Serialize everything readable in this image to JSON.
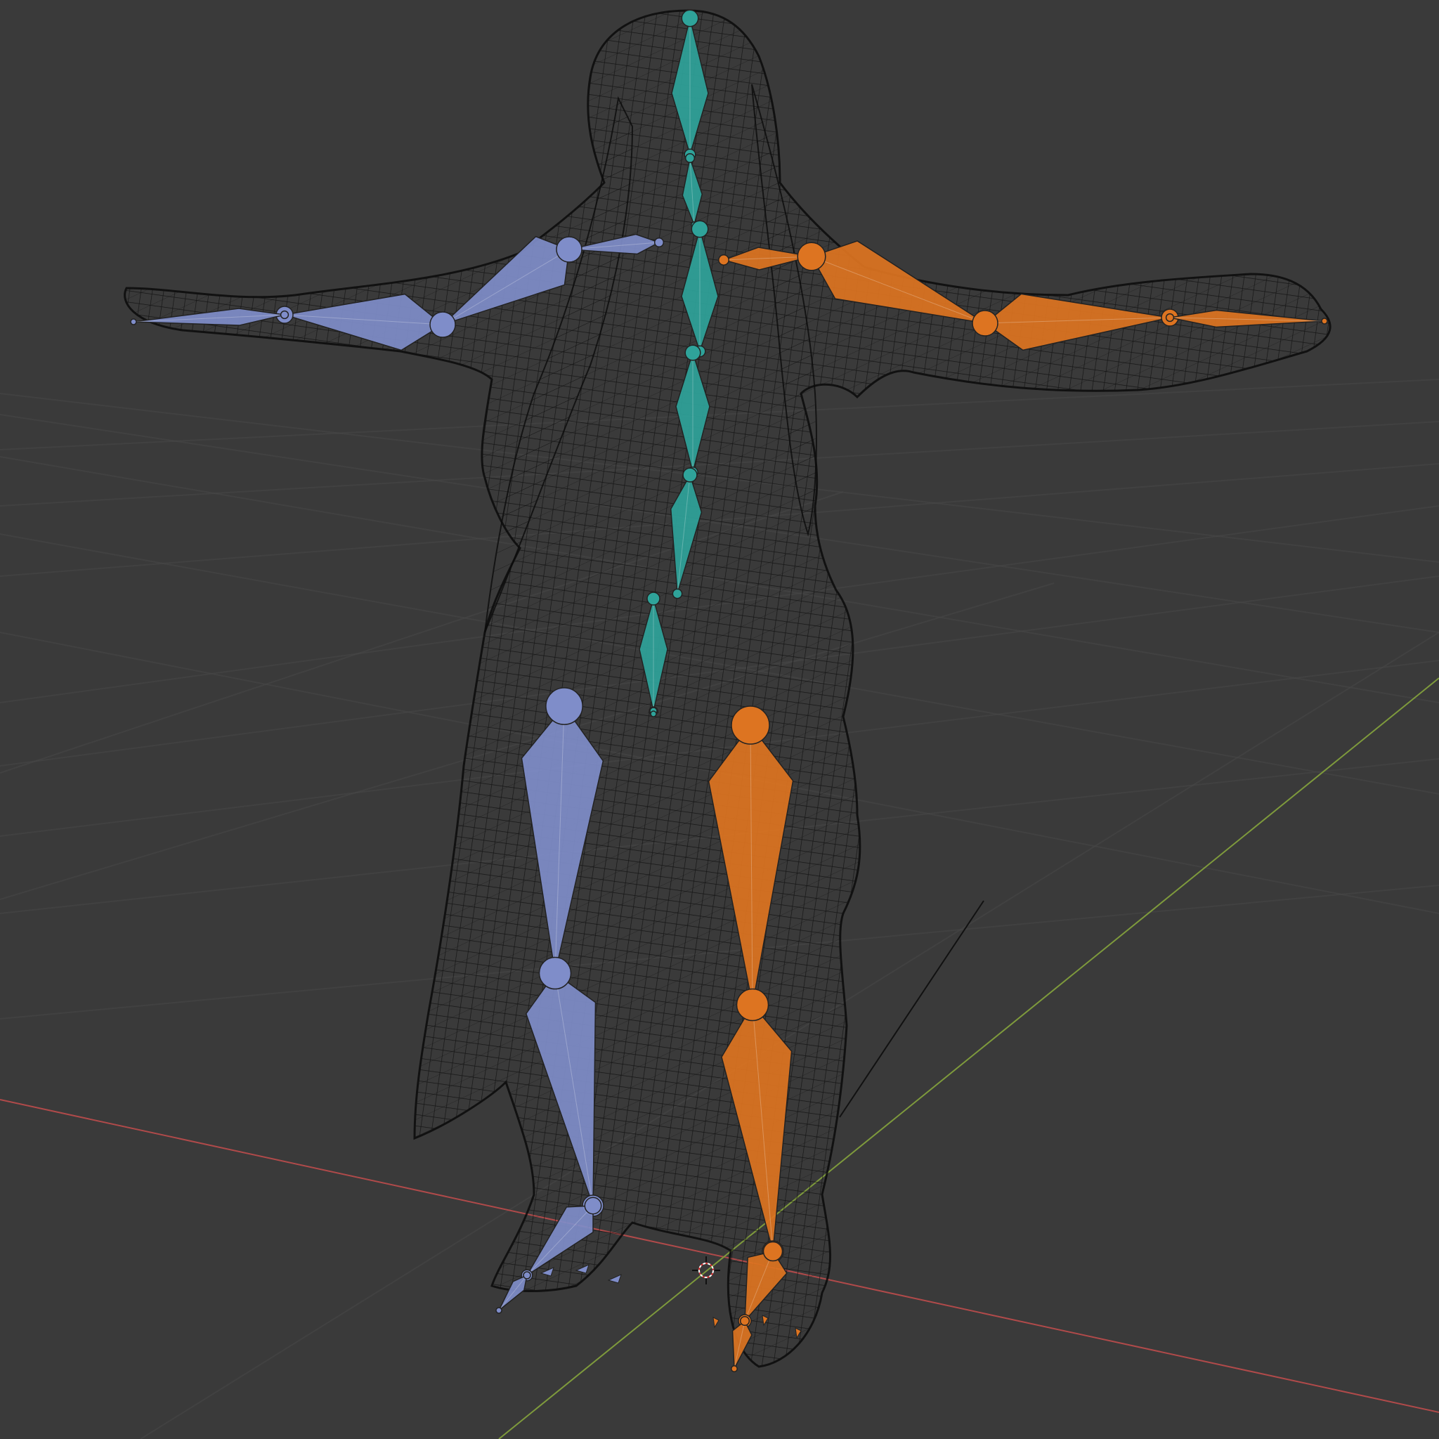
{
  "viewport": {
    "background_color": "#3a3a3a",
    "grid_line_color": "#474747",
    "x_axis_color": "#b04a4a",
    "y_axis_color": "#7e9a3c",
    "wire_color": "#0b0b0b",
    "cursor_icon": "3d-cursor-icon"
  },
  "armature": {
    "spine_color": "#2fa39a",
    "left_color": "#7f8dc9",
    "right_color": "#dd7421",
    "spine_bones": [
      "head",
      "neck",
      "chest",
      "upper-spine",
      "spine",
      "lower-spine",
      "hips"
    ],
    "left_bones": [
      "shoulder-left",
      "upper-arm-left",
      "forearm-left",
      "hand-left",
      "thigh-left",
      "shin-left",
      "foot-left",
      "toe-left"
    ],
    "right_bones": [
      "shoulder-right",
      "upper-arm-right",
      "forearm-right",
      "hand-right",
      "thigh-right",
      "shin-right",
      "foot-right",
      "toe-right"
    ]
  }
}
